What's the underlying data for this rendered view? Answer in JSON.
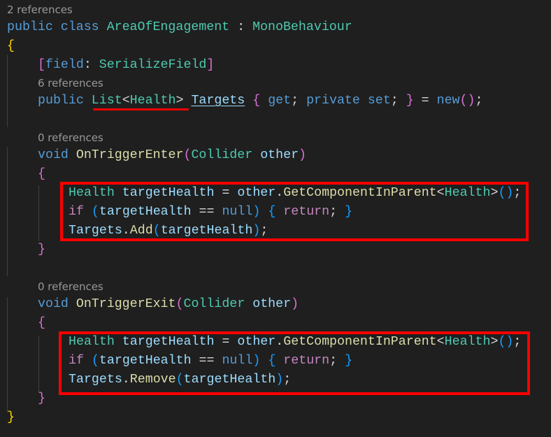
{
  "code_lines": [
    {
      "kind": "ref",
      "indent": 0,
      "tokens": [
        [
          "2 references",
          ""
        ]
      ]
    },
    {
      "kind": "code",
      "indent": 0,
      "tokens": [
        [
          "public ",
          "kw"
        ],
        [
          "class ",
          "kw"
        ],
        [
          "AreaOfEngagement",
          "type"
        ],
        [
          " : ",
          "op"
        ],
        [
          "MonoBehaviour",
          "type"
        ]
      ]
    },
    {
      "kind": "code",
      "indent": 0,
      "tokens": [
        [
          "{",
          "b1"
        ]
      ]
    },
    {
      "kind": "code",
      "indent": 1,
      "tokens": [
        [
          "[",
          "b2"
        ],
        [
          "field",
          "kw"
        ],
        [
          ": ",
          "op"
        ],
        [
          "SerializeField",
          "type"
        ],
        [
          "]",
          "b2"
        ]
      ]
    },
    {
      "kind": "ref",
      "indent": 1,
      "tokens": [
        [
          "6 references",
          ""
        ]
      ]
    },
    {
      "kind": "code",
      "indent": 1,
      "tokens": [
        [
          "public ",
          "kw"
        ],
        [
          "List",
          "type"
        ],
        [
          "<",
          "op"
        ],
        [
          "Health",
          "type"
        ],
        [
          "> ",
          "op"
        ],
        [
          "Targets",
          "link"
        ],
        [
          " ",
          "op"
        ],
        [
          "{",
          "b2"
        ],
        [
          " get",
          "kw"
        ],
        [
          "; ",
          "op"
        ],
        [
          "private ",
          "kw"
        ],
        [
          "set",
          "kw"
        ],
        [
          "; ",
          "op"
        ],
        [
          "}",
          "b2"
        ],
        [
          " = ",
          "op"
        ],
        [
          "new",
          "kw"
        ],
        [
          "()",
          "b2"
        ],
        [
          ";",
          "op"
        ]
      ]
    },
    {
      "kind": "blank",
      "indent": 1,
      "tokens": []
    },
    {
      "kind": "ref",
      "indent": 1,
      "tokens": [
        [
          "0 references",
          ""
        ]
      ]
    },
    {
      "kind": "code",
      "indent": 1,
      "tokens": [
        [
          "void ",
          "kw"
        ],
        [
          "OnTriggerEnter",
          "fn"
        ],
        [
          "(",
          "b2"
        ],
        [
          "Collider ",
          "type"
        ],
        [
          "other",
          "var"
        ],
        [
          ")",
          "b2"
        ]
      ]
    },
    {
      "kind": "code",
      "indent": 1,
      "tokens": [
        [
          "{",
          "b2"
        ]
      ]
    },
    {
      "kind": "code",
      "indent": 2,
      "tokens": [
        [
          "Health ",
          "type"
        ],
        [
          "targetHealth",
          "var"
        ],
        [
          " = ",
          "op"
        ],
        [
          "other",
          "var"
        ],
        [
          ".",
          "op"
        ],
        [
          "GetComponentInParent",
          "fn"
        ],
        [
          "<",
          "op"
        ],
        [
          "Health",
          "type"
        ],
        [
          ">",
          "op"
        ],
        [
          "()",
          "b3"
        ],
        [
          ";",
          "op"
        ]
      ]
    },
    {
      "kind": "code",
      "indent": 2,
      "tokens": [
        [
          "if ",
          "ctl"
        ],
        [
          "(",
          "b3"
        ],
        [
          "targetHealth",
          "var"
        ],
        [
          " == ",
          "op"
        ],
        [
          "null",
          "kw"
        ],
        [
          ")",
          "b3"
        ],
        [
          " ",
          "op"
        ],
        [
          "{",
          "b3"
        ],
        [
          " ",
          "op"
        ],
        [
          "return",
          "ctl"
        ],
        [
          "; ",
          "op"
        ],
        [
          "}",
          "b3"
        ]
      ]
    },
    {
      "kind": "code",
      "indent": 2,
      "tokens": [
        [
          "Targets",
          "var"
        ],
        [
          ".",
          "op"
        ],
        [
          "Add",
          "fn"
        ],
        [
          "(",
          "b3"
        ],
        [
          "targetHealth",
          "var"
        ],
        [
          ")",
          "b3"
        ],
        [
          ";",
          "op"
        ]
      ]
    },
    {
      "kind": "code",
      "indent": 1,
      "tokens": [
        [
          "}",
          "b2"
        ]
      ]
    },
    {
      "kind": "blank",
      "indent": 1,
      "tokens": []
    },
    {
      "kind": "ref",
      "indent": 1,
      "tokens": [
        [
          "0 references",
          ""
        ]
      ]
    },
    {
      "kind": "code",
      "indent": 1,
      "tokens": [
        [
          "void ",
          "kw"
        ],
        [
          "OnTriggerExit",
          "fn"
        ],
        [
          "(",
          "b2"
        ],
        [
          "Collider ",
          "type"
        ],
        [
          "other",
          "var"
        ],
        [
          ")",
          "b2"
        ]
      ]
    },
    {
      "kind": "code",
      "indent": 1,
      "tokens": [
        [
          "{",
          "b2"
        ]
      ]
    },
    {
      "kind": "code",
      "indent": 2,
      "tokens": [
        [
          "Health ",
          "type"
        ],
        [
          "targetHealth",
          "var"
        ],
        [
          " = ",
          "op"
        ],
        [
          "other",
          "var"
        ],
        [
          ".",
          "op"
        ],
        [
          "GetComponentInParent",
          "fn"
        ],
        [
          "<",
          "op"
        ],
        [
          "Health",
          "type"
        ],
        [
          ">",
          "op"
        ],
        [
          "()",
          "b3"
        ],
        [
          ";",
          "op"
        ]
      ]
    },
    {
      "kind": "code",
      "indent": 2,
      "tokens": [
        [
          "if ",
          "ctl"
        ],
        [
          "(",
          "b3"
        ],
        [
          "targetHealth",
          "var"
        ],
        [
          " == ",
          "op"
        ],
        [
          "null",
          "kw"
        ],
        [
          ")",
          "b3"
        ],
        [
          " ",
          "op"
        ],
        [
          "{",
          "b3"
        ],
        [
          " ",
          "op"
        ],
        [
          "return",
          "ctl"
        ],
        [
          "; ",
          "op"
        ],
        [
          "}",
          "b3"
        ]
      ]
    },
    {
      "kind": "code",
      "indent": 2,
      "tokens": [
        [
          "Targets",
          "var"
        ],
        [
          ".",
          "op"
        ],
        [
          "Remove",
          "fn"
        ],
        [
          "(",
          "b3"
        ],
        [
          "targetHealth",
          "var"
        ],
        [
          ")",
          "b3"
        ],
        [
          ";",
          "op"
        ]
      ]
    },
    {
      "kind": "code",
      "indent": 1,
      "tokens": [
        [
          "}",
          "b2"
        ]
      ]
    },
    {
      "kind": "code",
      "indent": 0,
      "tokens": [
        [
          "}",
          "b1"
        ]
      ]
    }
  ],
  "colors": {
    "background": "#1f1f1f",
    "annotation": "#ff0000"
  }
}
